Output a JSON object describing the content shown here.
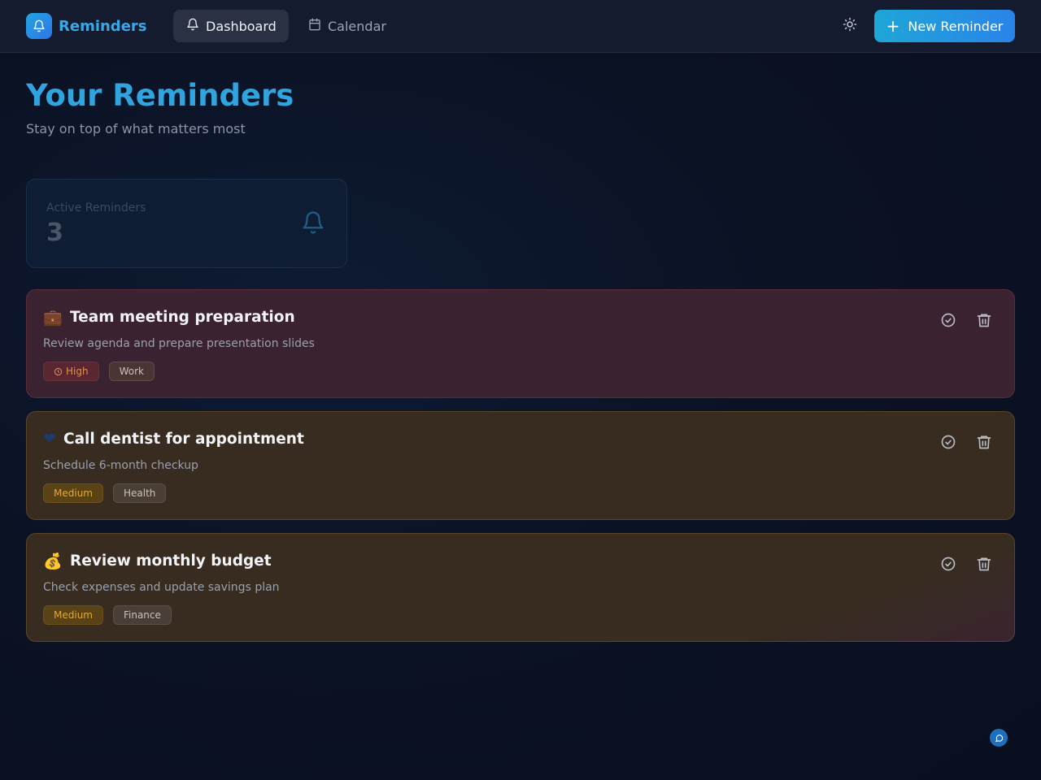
{
  "header": {
    "brand_name": "Reminders",
    "tabs": [
      {
        "label": "Dashboard",
        "icon": "bell-icon",
        "active": true
      },
      {
        "label": "Calendar",
        "icon": "calendar-icon",
        "active": false
      }
    ],
    "theme_icon": "sun-icon",
    "new_button_label": "New Reminder"
  },
  "page": {
    "title": "Your Reminders",
    "subtitle": "Stay on top of what matters most"
  },
  "stats": {
    "active_label": "Active Reminders",
    "active_value": "3"
  },
  "reminders": [
    {
      "emoji": "💼",
      "title": "Team meeting preparation",
      "description": "Review agenda and prepare presentation slides",
      "priority": "High",
      "category": "Work"
    },
    {
      "emoji": "❤",
      "title": "Call dentist for appointment",
      "description": "Schedule 6-month checkup",
      "priority": "Medium",
      "category": "Health"
    },
    {
      "emoji": "💰",
      "title": "Review monthly budget",
      "description": "Check expenses and update savings plan",
      "priority": "Medium",
      "category": "Finance"
    }
  ],
  "colors": {
    "accent": "#2fa4df",
    "high_card": "#3a2231",
    "medium_card": "#372c1f",
    "high_tag_text": "#e0914d",
    "medium_tag_text": "#e0a83a"
  }
}
